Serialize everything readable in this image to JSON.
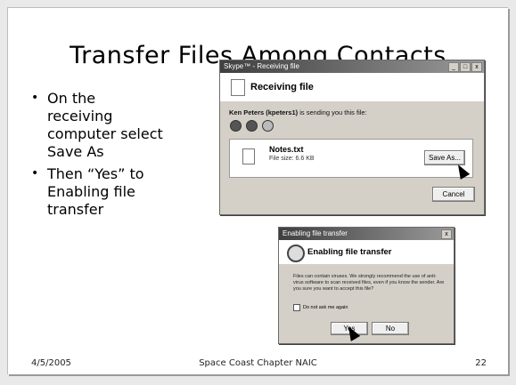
{
  "slide": {
    "title": "Transfer Files Among Contacts",
    "bullets": [
      "On the receiving computer select Save As",
      "Then “Yes” to Enabling file transfer"
    ],
    "bullet_symbol": "•",
    "footer": {
      "date": "4/5/2005",
      "center": "Space Coast Chapter NAIC",
      "page": "22"
    }
  },
  "receiving_window": {
    "title": "Skype™ - Receiving file",
    "controls": [
      "_",
      "□",
      "x"
    ],
    "heading": "Receiving file",
    "sender_name": "Ken Peters (kpeters1)",
    "sender_text": "is sending you this file:",
    "file_name": "Notes.txt",
    "file_size": "File size: 6.6 KB",
    "save_button": "Save As...",
    "cancel_button": "Cancel"
  },
  "enabling_window": {
    "title": "Enabling file transfer",
    "close": "x",
    "heading": "Enabling file transfer",
    "warning": "Files can contain viruses. We strongly recommend the use of anti-virus software to scan received files, even if you know the sender. Are you sure you want to accept this file?",
    "checkbox_label": "Do not ask me again",
    "yes_button": "Yes",
    "no_button": "No"
  }
}
